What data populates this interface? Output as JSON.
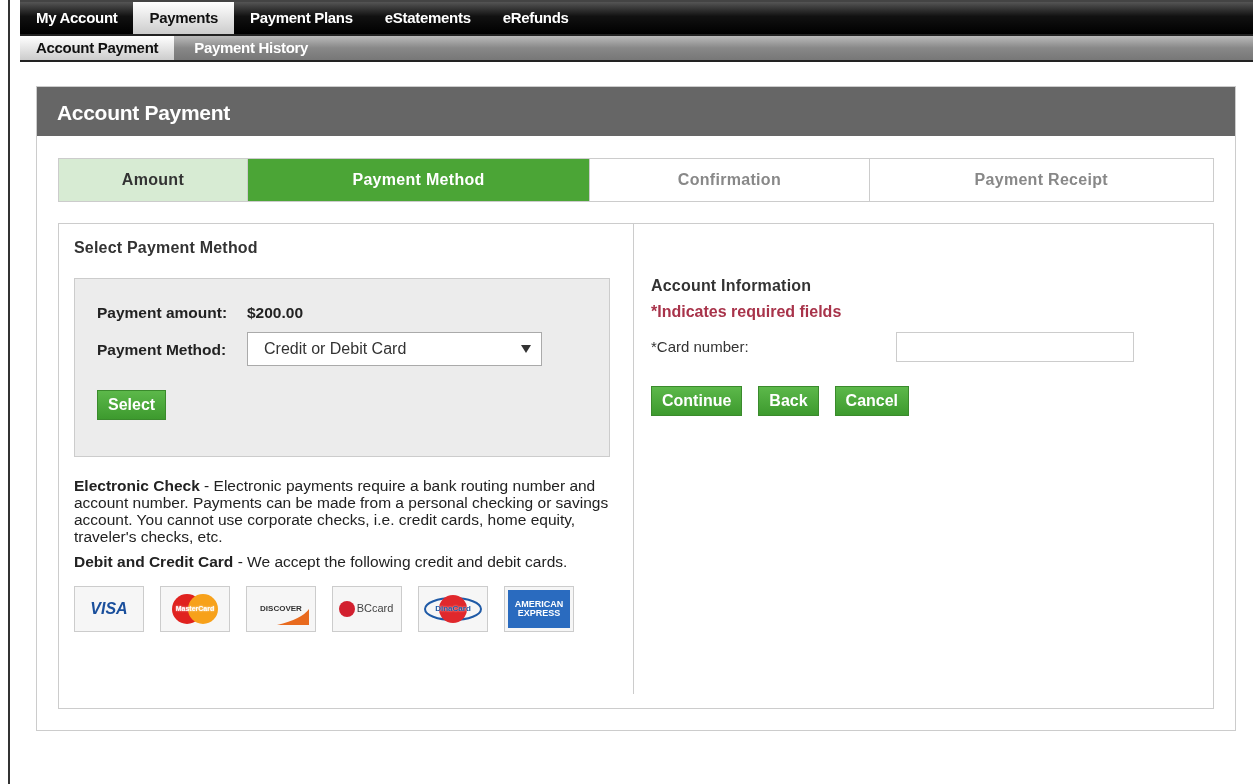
{
  "main_tabs": [
    {
      "label": "My Account",
      "selected": false
    },
    {
      "label": "Payments",
      "selected": true
    },
    {
      "label": "Payment Plans",
      "selected": false
    },
    {
      "label": "eStatements",
      "selected": false
    },
    {
      "label": "eRefunds",
      "selected": false
    }
  ],
  "sub_tabs": [
    {
      "label": "Account Payment",
      "selected": true
    },
    {
      "label": "Payment History",
      "selected": false
    }
  ],
  "panel_title": "Account Payment",
  "steps": [
    {
      "label": "Amount",
      "completed": true,
      "selected": false
    },
    {
      "label": "Payment Method",
      "completed": false,
      "selected": true
    },
    {
      "label": "Confirmation",
      "completed": false,
      "selected": false
    },
    {
      "label": "Payment Receipt",
      "completed": false,
      "selected": false
    }
  ],
  "section_title": "Select Payment Method",
  "amount_label": "Payment amount:",
  "amount_value": "$200.00",
  "method_label": "Payment Method:",
  "method_value": "Credit or Debit Card",
  "select_button": "Select",
  "notes": [
    {
      "title": "Electronic Check",
      "text": " - Electronic payments require a bank routing number and account number. Payments can be made from a personal checking or savings account. You cannot use corporate checks, i.e. credit cards, home equity, traveler's checks, etc."
    },
    {
      "title": "Debit and Credit Card",
      "text": " - We accept the following credit and debit cards."
    }
  ],
  "cards": [
    {
      "kind": "visa",
      "label": "VISA"
    },
    {
      "kind": "mastercard",
      "label": "MasterCard"
    },
    {
      "kind": "discover",
      "label": "DISCOVER"
    },
    {
      "kind": "bccard",
      "label": "BCcard"
    },
    {
      "kind": "dinacard",
      "label": "DinaCard"
    },
    {
      "kind": "amex",
      "label": "AMERICAN EXPRESS"
    }
  ],
  "account_title": "Account Information",
  "required_note": "*Indicates required fields",
  "card_number_label": "*Card number:",
  "buttons": [
    "Continue",
    "Back",
    "Cancel"
  ]
}
